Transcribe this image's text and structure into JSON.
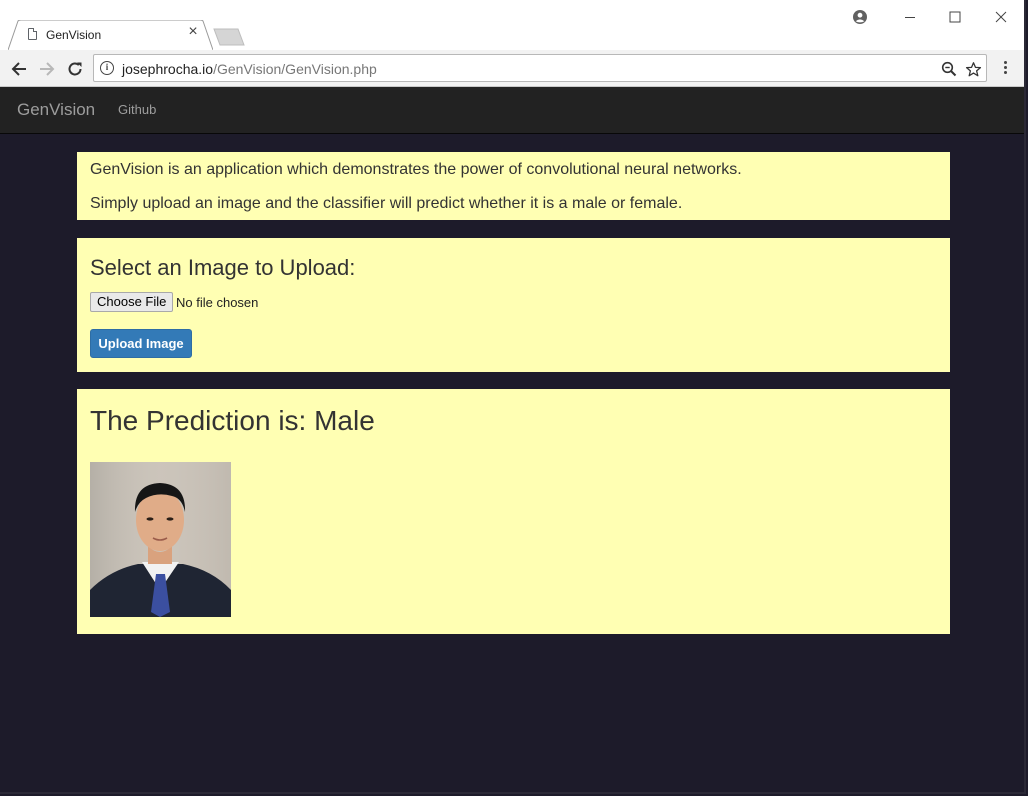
{
  "browser": {
    "tab_title": "GenVision",
    "tab_close": "×",
    "url_host": "josephrocha.io",
    "url_path": "/GenVision/GenVision.php"
  },
  "navbar": {
    "brand": "GenVision",
    "links": [
      "Github"
    ]
  },
  "intro": {
    "line1": "GenVision is an application which demonstrates the power of convolutional neural networks.",
    "line2": "Simply upload an image and the classifier will predict whether it is a male or female."
  },
  "upload": {
    "heading": "Select an Image to Upload:",
    "choose_file_label": "Choose File",
    "file_status": "No file chosen",
    "upload_button_label": "Upload Image"
  },
  "result": {
    "heading": "The Prediction is: Male"
  },
  "colors": {
    "panel_bg": "#ffffb3",
    "page_bg": "#1d1b2a",
    "navbar_bg": "#222222",
    "primary_button": "#337ab7"
  },
  "icons": [
    "document-icon",
    "close-icon",
    "back-icon",
    "forward-icon",
    "reload-icon",
    "info-icon",
    "zoom-icon",
    "star-icon",
    "menu-icon",
    "profile-icon",
    "minimize-icon",
    "maximize-icon",
    "window-close-icon"
  ]
}
